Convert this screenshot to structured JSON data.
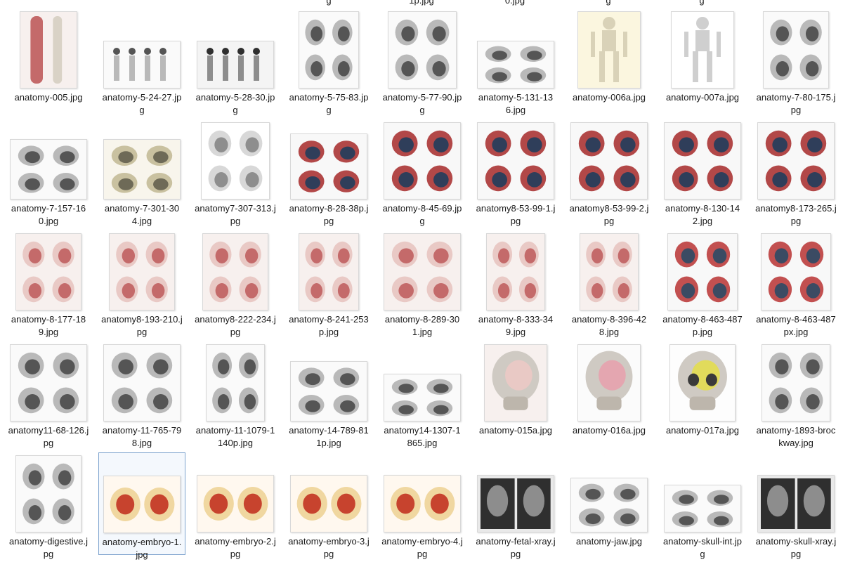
{
  "top_fragments": [
    "g",
    "1p.jpg",
    "0.jpg",
    "g",
    "g"
  ],
  "rows": [
    [
      {
        "name": "anatomy-005.jpg",
        "kind": "leg-bone",
        "tone": "red"
      },
      {
        "name": "anatomy-5-24-27.jpg",
        "kind": "skeleton-row",
        "tone": "gray"
      },
      {
        "name": "anatomy-5-28-30.jpg",
        "kind": "skeleton-row",
        "tone": "dark"
      },
      {
        "name": "anatomy-5-75-83.jpg",
        "kind": "torso-grid",
        "tone": "gray"
      },
      {
        "name": "anatomy-5-77-90.jpg",
        "kind": "sketch-grid",
        "tone": "gray"
      },
      {
        "name": "anatomy-5-131-136.jpg",
        "kind": "feet",
        "tone": "gray"
      },
      {
        "name": "anatomy-006a.jpg",
        "kind": "skeleton",
        "tone": "cream"
      },
      {
        "name": "anatomy-007a.jpg",
        "kind": "skeleton",
        "tone": "white"
      },
      {
        "name": "anatomy-7-80-175.jpg",
        "kind": "hands",
        "tone": "gray"
      }
    ],
    [
      {
        "name": "anatomy-7-157-160.jpg",
        "kind": "torso-pair",
        "tone": "gray"
      },
      {
        "name": "anatomy-7-301-304.jpg",
        "kind": "torso-pair",
        "tone": "beige"
      },
      {
        "name": "anatomy7-307-313.jpg",
        "kind": "sketch-grid",
        "tone": "light"
      },
      {
        "name": "anatomy-8-28-38p.jpg",
        "kind": "tissue",
        "tone": "red-blue"
      },
      {
        "name": "anatomy-8-45-69.jpg",
        "kind": "hearts",
        "tone": "red-blue"
      },
      {
        "name": "anatomy8-53-99-1.jpg",
        "kind": "hearts",
        "tone": "red-blue"
      },
      {
        "name": "anatomy8-53-99-2.jpg",
        "kind": "hearts",
        "tone": "red-blue"
      },
      {
        "name": "anatomy-8-130-142.jpg",
        "kind": "hearts",
        "tone": "red-blue"
      },
      {
        "name": "anatomy8-173-265.jpg",
        "kind": "hearts",
        "tone": "red-blue"
      }
    ],
    [
      {
        "name": "anatomy-8-177-189.jpg",
        "kind": "organs",
        "tone": "red"
      },
      {
        "name": "anatomy8-193-210.jpg",
        "kind": "organs",
        "tone": "red"
      },
      {
        "name": "anatomy8-222-234.jpg",
        "kind": "organs",
        "tone": "red"
      },
      {
        "name": "anatomy-8-241-253p.jpg",
        "kind": "torso-grid",
        "tone": "red"
      },
      {
        "name": "anatomy-8-289-301.jpg",
        "kind": "brain",
        "tone": "red"
      },
      {
        "name": "anatomy-8-333-349.jpg",
        "kind": "limbs",
        "tone": "red"
      },
      {
        "name": "anatomy-8-396-428.jpg",
        "kind": "limbs",
        "tone": "red"
      },
      {
        "name": "anatomy-8-463-487p.jpg",
        "kind": "spine",
        "tone": "blue-red"
      },
      {
        "name": "anatomy-8-463-487px.jpg",
        "kind": "spine",
        "tone": "blue-red"
      }
    ],
    [
      {
        "name": "anatomy11-68-126.jpg",
        "kind": "hearts",
        "tone": "gray"
      },
      {
        "name": "anatomy-11-765-798.jpg",
        "kind": "brain",
        "tone": "gray"
      },
      {
        "name": "anatomy-11-1079-1140p.jpg",
        "kind": "limbs",
        "tone": "gray"
      },
      {
        "name": "anatomy-14-789-811p.jpg",
        "kind": "vertebrae",
        "tone": "gray"
      },
      {
        "name": "anatomy14-1307-1865.jpg",
        "kind": "feet",
        "tone": "gray"
      },
      {
        "name": "anatomy-015a.jpg",
        "kind": "skull-side",
        "tone": "red"
      },
      {
        "name": "anatomy-016a.jpg",
        "kind": "skull-side",
        "tone": "pink"
      },
      {
        "name": "anatomy-017a.jpg",
        "kind": "skull-front",
        "tone": "yellow"
      },
      {
        "name": "anatomy-1893-brockway.jpg",
        "kind": "sketch-grid",
        "tone": "gray"
      }
    ],
    [
      {
        "name": "anatomy-digestive.jpg",
        "kind": "organs",
        "tone": "gray"
      },
      {
        "name": "anatomy-embryo-1.jpg",
        "kind": "embryo",
        "tone": "red-yellow",
        "selected": true
      },
      {
        "name": "anatomy-embryo-2.jpg",
        "kind": "embryo",
        "tone": "red-yellow"
      },
      {
        "name": "anatomy-embryo-3.jpg",
        "kind": "embryo",
        "tone": "red-yellow"
      },
      {
        "name": "anatomy-embryo-4.jpg",
        "kind": "embryo",
        "tone": "red-yellow"
      },
      {
        "name": "anatomy-fetal-xray.jpg",
        "kind": "xray",
        "tone": "dark"
      },
      {
        "name": "anatomy-jaw.jpg",
        "kind": "jaw",
        "tone": "gray"
      },
      {
        "name": "anatomy-skull-int.jpg",
        "kind": "skull-int",
        "tone": "gray"
      },
      {
        "name": "anatomy-skull-xray.jpg",
        "kind": "xray",
        "tone": "dark"
      }
    ]
  ]
}
